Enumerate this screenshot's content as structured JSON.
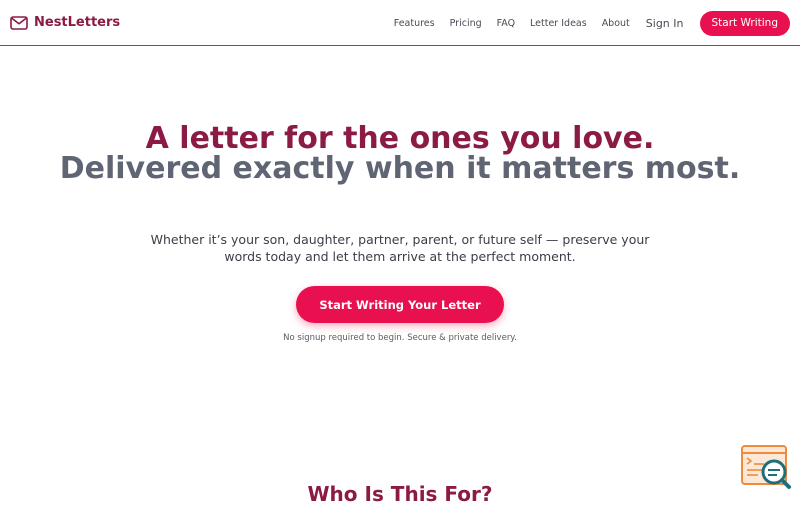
{
  "brand": {
    "name": "NestLetters",
    "icon": "envelope-icon",
    "color": "#8b1a45"
  },
  "nav": {
    "links": [
      "Features",
      "Pricing",
      "FAQ",
      "Letter Ideas",
      "About"
    ],
    "signin": "Sign In",
    "cta": "Start Writing"
  },
  "hero": {
    "title_line1": "A letter for the ones you love.",
    "title_line2": "Delivered exactly when it matters most.",
    "subtitle": "Whether it’s your son, daughter, partner, parent, or future self — preserve your words today and let them arrive at the perfect moment.",
    "cta": "Start Writing Your Letter",
    "note": "No signup required to begin. Secure & private delivery."
  },
  "section": {
    "title": "Who Is This For?"
  },
  "widget": {
    "icon": "chat-search-icon"
  },
  "colors": {
    "accent": "#e8104e",
    "brand": "#8b1a45",
    "muted_heading": "#5f6573",
    "widget_orange": "#f08a3c",
    "widget_teal": "#1f6f7a"
  }
}
